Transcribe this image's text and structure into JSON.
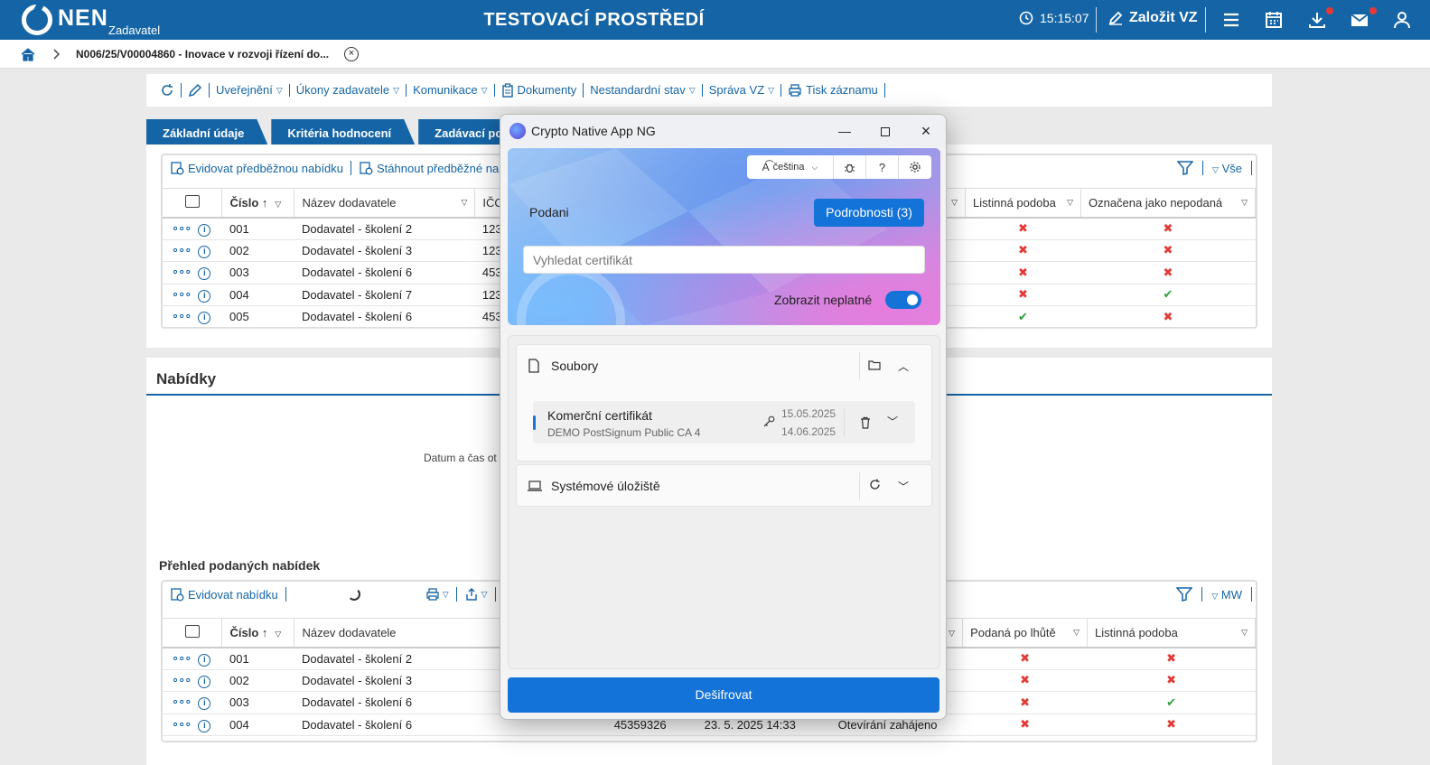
{
  "header": {
    "brand": "NEN",
    "brand_sub": "Zadavatel",
    "env_title": "TESTOVACÍ PROSTŘEDÍ",
    "clock": "15:15:07",
    "create_vz": "Založit VZ"
  },
  "breadcrumb": {
    "text": "N006/25/V00004860 - Inovace v rozvoji řízení do..."
  },
  "toolbar": {
    "items": [
      "Uveřejnění",
      "Úkony zadavatele",
      "Komunikace",
      "Dokumenty",
      "Nestandardní stav",
      "Správa VZ",
      "Tisk záznamu"
    ]
  },
  "tabs": [
    "Základní údaje",
    "Kritéria hodnocení",
    "Zadávací podm"
  ],
  "grid1": {
    "tools": [
      "Evidovat předběžnou nabídku",
      "Stáhnout předběžné nabíd"
    ],
    "filter_label": "Vše",
    "columns": [
      "Číslo",
      "Název dodavatele",
      "IČO",
      "Listinná podoba",
      "Označena jako nepodaná"
    ],
    "rows": [
      {
        "cislo": "001",
        "nazev": "Dodavatel - školení 2",
        "ico": "123",
        "listinna": "x",
        "nepodana": "x"
      },
      {
        "cislo": "002",
        "nazev": "Dodavatel - školení 3",
        "ico": "123",
        "listinna": "x",
        "nepodana": "x"
      },
      {
        "cislo": "003",
        "nazev": "Dodavatel - školení 6",
        "ico": "453",
        "listinna": "x",
        "nepodana": "x"
      },
      {
        "cislo": "004",
        "nazev": "Dodavatel - školení 7",
        "ico": "123",
        "listinna": "x",
        "nepodana": "ok"
      },
      {
        "cislo": "005",
        "nazev": "Dodavatel - školení 6",
        "ico": "453",
        "listinna": "ok",
        "nepodana": "x"
      }
    ]
  },
  "offers": {
    "title": "Nabídky",
    "date_label": "Datum a čas ot",
    "prehled": "Přehled podaných nabídek"
  },
  "grid2": {
    "tools": [
      "Evidovat nabídku"
    ],
    "filter_label": "MW",
    "columns": [
      "Číslo",
      "Název dodavatele",
      "Podaná po lhůtě",
      "Listinná podoba"
    ],
    "rows": [
      {
        "cislo": "001",
        "nazev": "Dodavatel - školení 2",
        "ico": "",
        "datum": "",
        "stav": "",
        "po_lhute": "x",
        "listinna": "x"
      },
      {
        "cislo": "002",
        "nazev": "Dodavatel - školení 3",
        "ico": "",
        "datum": "",
        "stav": "",
        "po_lhute": "x",
        "listinna": "x"
      },
      {
        "cislo": "003",
        "nazev": "Dodavatel - školení 6",
        "ico": "",
        "datum": "",
        "stav": "",
        "po_lhute": "x",
        "listinna": "ok"
      },
      {
        "cislo": "004",
        "nazev": "Dodavatel - školení 6",
        "ico": "45359326",
        "datum": "23. 5. 2025 14:33",
        "stav": "Otevírání zahájeno",
        "po_lhute": "x",
        "listinna": "x"
      }
    ]
  },
  "modal": {
    "title": "Crypto Native App NG",
    "language": "čeština",
    "podani": "Podani",
    "detail_button": "Podrobnosti (3)",
    "search_placeholder": "Vyhledat certifikát",
    "toggle_label": "Zobrazit neplatné",
    "toggle_on": true,
    "files_section": "Soubory",
    "cert": {
      "name": "Komerční certifikát",
      "issuer": "DEMO PostSignum Public CA 4",
      "valid_from": "15.05.2025",
      "valid_to": "14.06.2025"
    },
    "system_section": "Systémové úložiště",
    "decrypt_button": "Dešifrovat",
    "accent": "#1473d8"
  },
  "colors": {
    "brand": "#1565a6",
    "error": "#e53935",
    "success": "#2e9e3e"
  }
}
